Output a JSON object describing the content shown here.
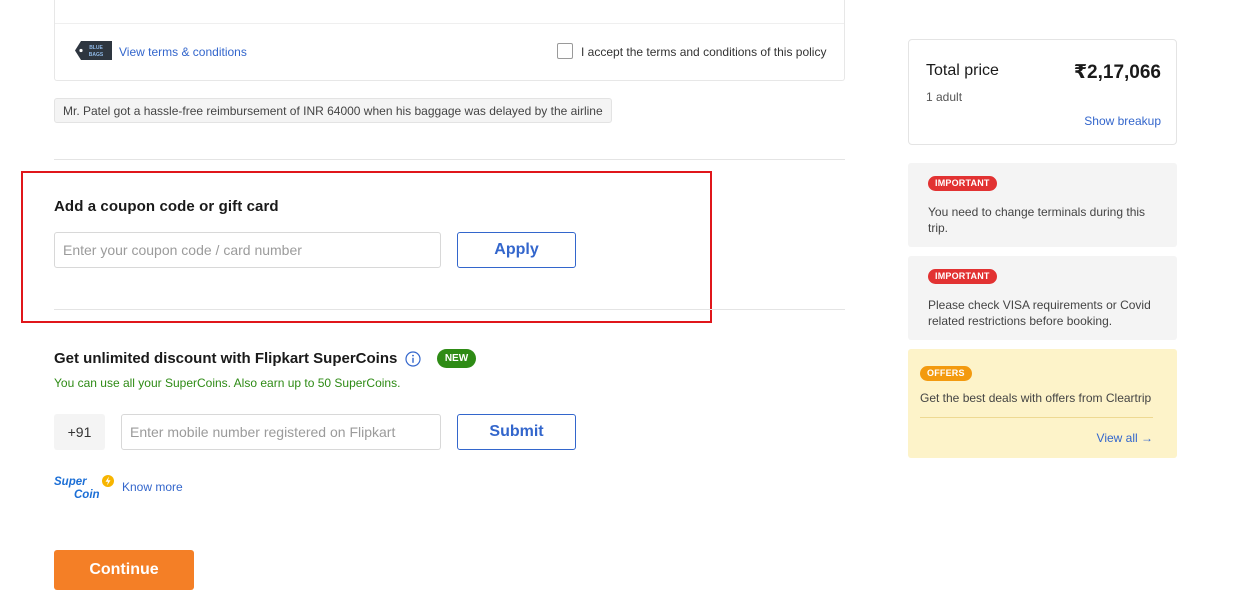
{
  "insurance": {
    "terms_link": "View terms & conditions",
    "accept_label": "I accept the terms and conditions of this policy",
    "logo_text": [
      "BLUE",
      "BAGS"
    ],
    "claim_story": "Mr. Patel got a hassle-free reimbursement of INR 64000 when his baggage was delayed by the airline"
  },
  "coupon": {
    "title": "Add a coupon code or gift card",
    "placeholder": "Enter your coupon code / card number",
    "apply_label": "Apply"
  },
  "supercoins": {
    "title": "Get unlimited discount with Flipkart SuperCoins",
    "badge": "NEW",
    "subtitle": "You can use all your SuperCoins. Also earn up to 50 SuperCoins.",
    "country_code": "+91",
    "placeholder": "Enter mobile number registered on Flipkart",
    "submit_label": "Submit",
    "logo_text": [
      "Super",
      "Coin"
    ],
    "know_more": "Know more"
  },
  "continue_label": "Continue",
  "price": {
    "label": "Total price",
    "value": "₹2,17,066",
    "pax": "1 adult",
    "breakup_link": "Show breakup"
  },
  "notices": [
    {
      "tag": "IMPORTANT",
      "text": "You need to change terminals during this trip."
    },
    {
      "tag": "IMPORTANT",
      "text": "Please check VISA requirements or Covid related restrictions before booking."
    }
  ],
  "offers": {
    "tag": "OFFERS",
    "text": "Get the best deals with offers from Cleartrip",
    "view_all": "View all →"
  },
  "colors": {
    "link": "#3366cc",
    "highlight": "#e0161b",
    "continue": "#f47f26",
    "new_badge": "#2e8b15",
    "important": "#e23232",
    "offers_tag": "#f39a0f",
    "offers_bg": "#fdf3c9"
  }
}
